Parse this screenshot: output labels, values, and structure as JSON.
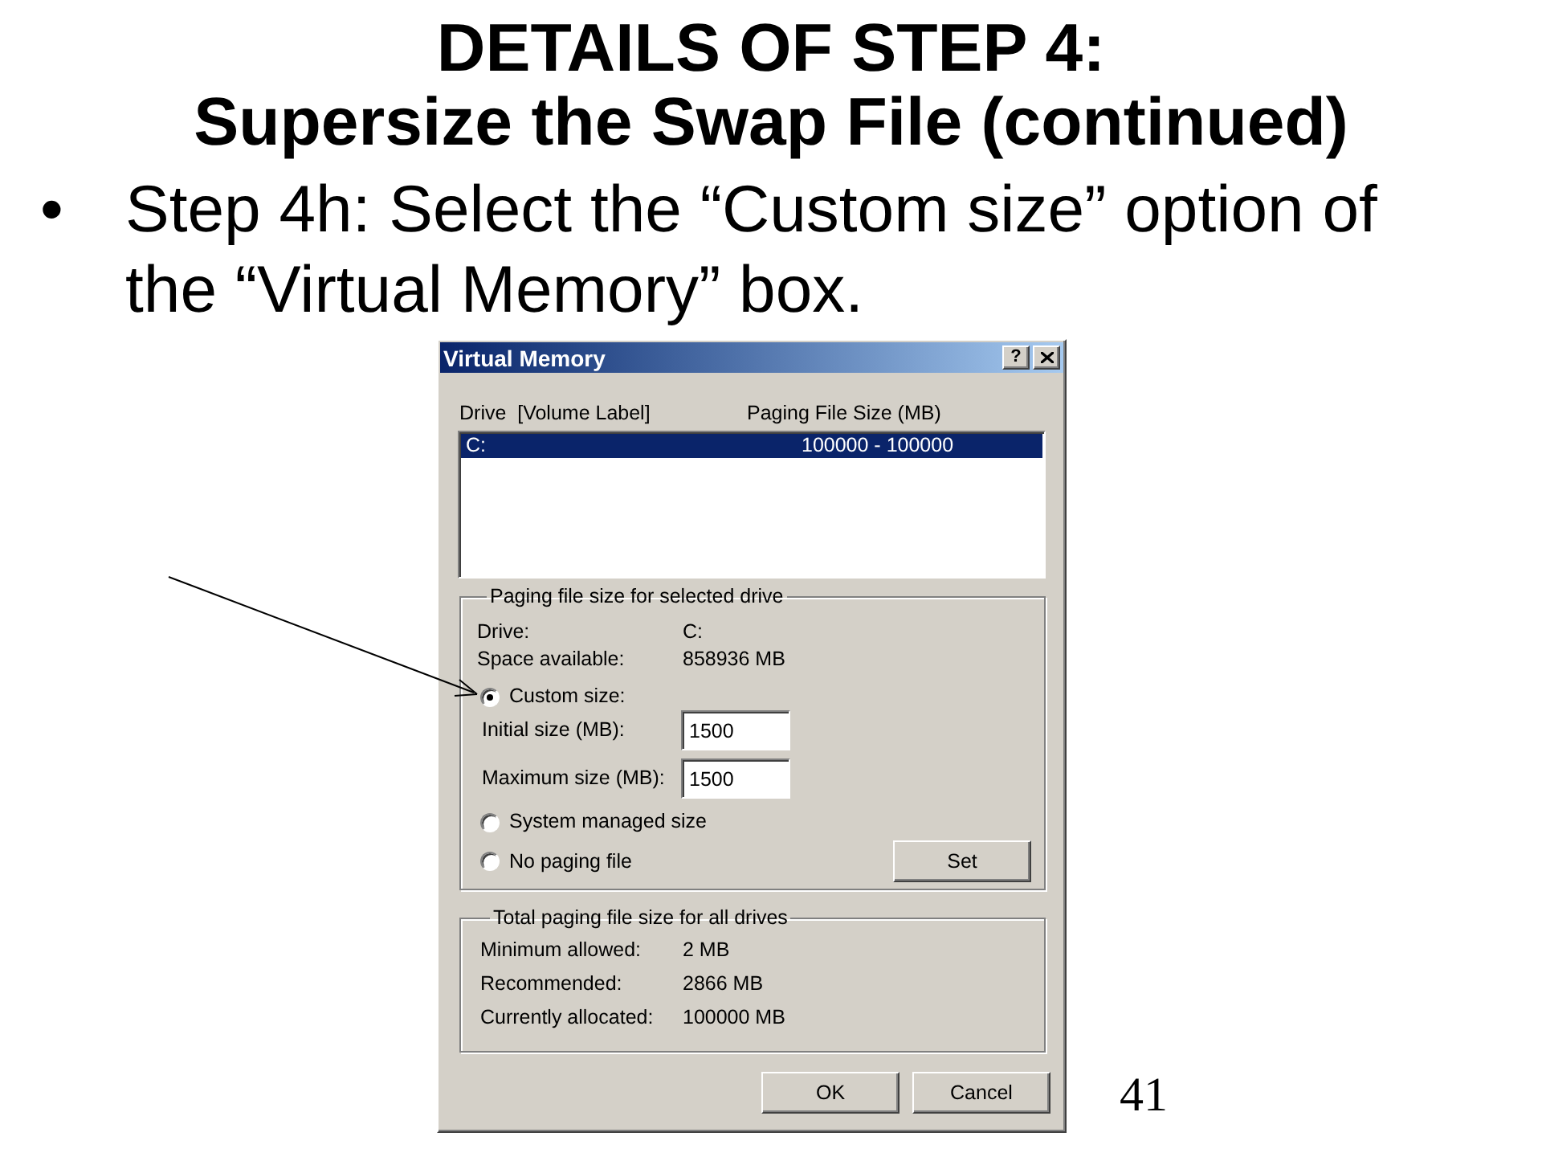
{
  "slide": {
    "title_lines": [
      "DETAILS OF STEP 4:",
      "Supersize the Swap File (continued)"
    ],
    "bullets": [
      {
        "marker": "•",
        "text": "Step 4h: Select the “Custom size” option of the “Virtual Memory” box."
      }
    ],
    "page_number": "41"
  },
  "dialog": {
    "title": "Virtual Memory",
    "help_button": "?",
    "drive_list": {
      "columns": [
        "Drive  [Volume Label]",
        "Paging File Size (MB)"
      ],
      "rows": [
        {
          "drive": "C:",
          "size": "100000 - 100000",
          "selected": true
        }
      ]
    },
    "selected_drive_group": {
      "legend": "Paging file size for selected drive",
      "info": [
        {
          "label": "Drive:",
          "value": "C:"
        },
        {
          "label": "Space available:",
          "value": "858936 MB"
        }
      ],
      "options": [
        {
          "kind": "radio",
          "label": "Custom size:",
          "selected": true
        },
        {
          "kind": "field",
          "label": "Initial size (MB):",
          "value": "1500"
        },
        {
          "kind": "field",
          "label": "Maximum size (MB):",
          "value": "1500"
        },
        {
          "kind": "radio",
          "label": "System managed size",
          "selected": false
        },
        {
          "kind": "radio",
          "label": "No paging file",
          "selected": false
        }
      ],
      "set_button": "Set"
    },
    "totals_group": {
      "legend": "Total paging file size for all drives",
      "rows": [
        {
          "label": "Minimum allowed:",
          "value": "2 MB"
        },
        {
          "label": "Recommended:",
          "value": "2866 MB"
        },
        {
          "label": "Currently allocated:",
          "value": "100000 MB"
        }
      ]
    },
    "buttons": [
      "OK",
      "Cancel"
    ]
  }
}
